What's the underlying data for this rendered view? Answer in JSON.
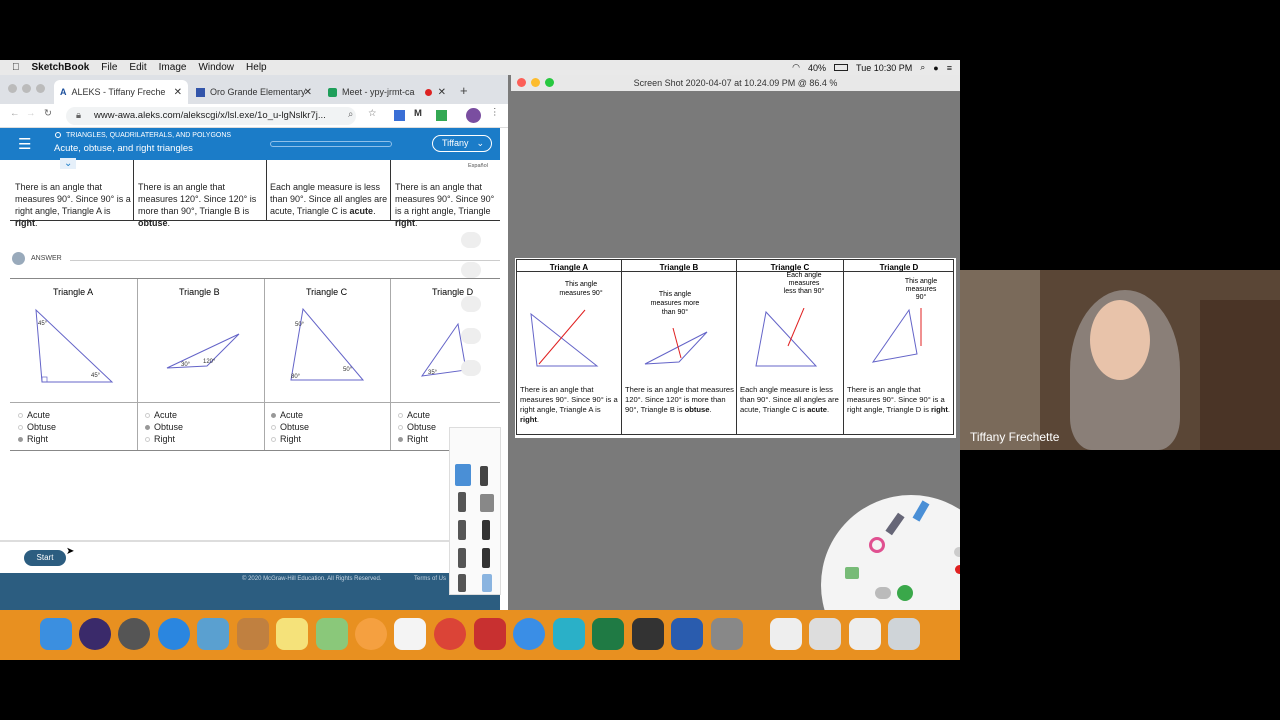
{
  "menubar": {
    "app_name": "SketchBook",
    "items": [
      "File",
      "Edit",
      "Image",
      "Window",
      "Help"
    ],
    "battery": "40%",
    "clock": "Tue 10:30 PM"
  },
  "browser": {
    "tabs": [
      {
        "label": "ALEKS - Tiffany Freche"
      },
      {
        "label": "Oro Grande Elementary"
      },
      {
        "label": "Meet - ypy-jrmt-ca"
      }
    ],
    "url": "www-awa.aleks.com/alekscgi/x/lsl.exe/1o_u-lgNslkr7j..."
  },
  "aleks": {
    "category": "TRIANGLES, QUADRILATERALS, AND POLYGONS",
    "topic": "Acute, obtuse, and right triangles",
    "user": "Tiffany",
    "espanol": "Español",
    "answer_label": "ANSWER",
    "explanations": [
      {
        "text": "There is an angle that measures 90°. Since 90° is a right angle, Triangle A is ",
        "bold": "right",
        "end": "."
      },
      {
        "text": "There is an angle that measures 120°. Since 120° is more than 90°, Triangle B is ",
        "bold": "obtuse",
        "end": "."
      },
      {
        "text": "Each angle measure is less than 90°. Since all angles are acute, Triangle C is ",
        "bold": "acute",
        "end": "."
      },
      {
        "text": "There is an angle that measures 90°. Since 90° is a right angle, Triangle ",
        "bold": "right",
        "end": "."
      }
    ],
    "triangles": [
      {
        "title": "Triangle A",
        "options": [
          "Acute",
          "Obtuse",
          "Right"
        ],
        "selected": 2,
        "angles": [
          "45°",
          "45°"
        ]
      },
      {
        "title": "Triangle B",
        "options": [
          "Acute",
          "Obtuse",
          "Right"
        ],
        "selected": 1,
        "angles": [
          "30°",
          "120°"
        ]
      },
      {
        "title": "Triangle C",
        "options": [
          "Acute",
          "Obtuse",
          "Right"
        ],
        "selected": 0,
        "angles": [
          "50°",
          "80°",
          "50°"
        ]
      },
      {
        "title": "Triangle D",
        "options": [
          "Acute",
          "Obtuse",
          "Right"
        ],
        "selected": 2,
        "angles": [
          "35°"
        ]
      }
    ],
    "start_button": "Start",
    "footer": "© 2020 McGraw-Hill Education. All Rights Reserved.",
    "terms": "Terms of Us"
  },
  "sketchbook": {
    "title": "Screen Shot 2020-04-07 at 10.24.09 PM @ 86.4 %",
    "columns": [
      {
        "title": "Triangle A",
        "note": "This angle measures 90°",
        "caption": "There is an angle that measures 90°. Since 90° is a right angle, Triangle A is ",
        "bold": "right"
      },
      {
        "title": "Triangle B",
        "note": "This angle measures more than 90°",
        "caption": "There is an angle that measures 120°. Since 120° is more than 90°, Triangle B is ",
        "bold": "obtuse"
      },
      {
        "title": "Triangle C",
        "note": "Each angle measures less than 90°",
        "caption": "Each angle measure is less than 90°. Since all angles are acute, Triangle C is ",
        "bold": "acute"
      },
      {
        "title": "Triangle D",
        "note": "This angle measures 90°",
        "caption": "There is an angle that measures 90°. Since 90° is a right angle, Triangle D is ",
        "bold": "right"
      }
    ]
  },
  "webcam": {
    "name": "Tiffany Frechette"
  },
  "colors": {
    "aleks_blue": "#1b7cc8",
    "dock_orange": "#e89020",
    "annotation_red": "#e02020"
  }
}
